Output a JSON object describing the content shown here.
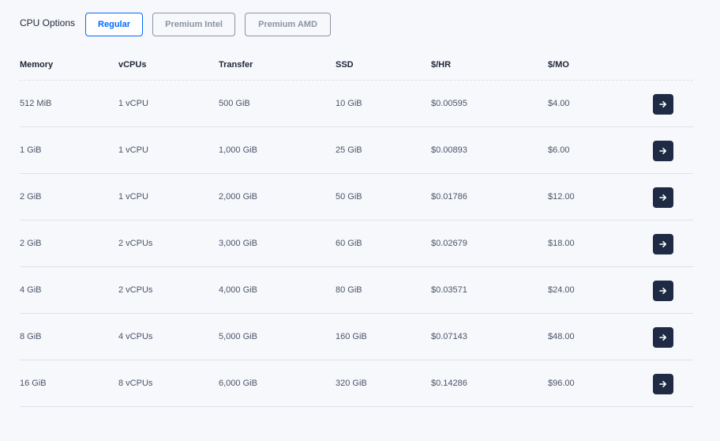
{
  "cpu_options": {
    "label": "CPU Options",
    "options": [
      {
        "label": "Regular",
        "selected": true
      },
      {
        "label": "Premium Intel",
        "selected": false
      },
      {
        "label": "Premium AMD",
        "selected": false
      }
    ]
  },
  "table": {
    "headers": [
      "Memory",
      "vCPUs",
      "Transfer",
      "SSD",
      "$/HR",
      "$/MO"
    ],
    "rows": [
      [
        "512 MiB",
        "1 vCPU",
        "500 GiB",
        "10 GiB",
        "$0.00595",
        "$4.00"
      ],
      [
        "1 GiB",
        "1 vCPU",
        "1,000 GiB",
        "25 GiB",
        "$0.00893",
        "$6.00"
      ],
      [
        "2 GiB",
        "1 vCPU",
        "2,000 GiB",
        "50 GiB",
        "$0.01786",
        "$12.00"
      ],
      [
        "2 GiB",
        "2 vCPUs",
        "3,000 GiB",
        "60 GiB",
        "$0.02679",
        "$18.00"
      ],
      [
        "4 GiB",
        "2 vCPUs",
        "4,000 GiB",
        "80 GiB",
        "$0.03571",
        "$24.00"
      ],
      [
        "8 GiB",
        "4 vCPUs",
        "5,000 GiB",
        "160 GiB",
        "$0.07143",
        "$48.00"
      ],
      [
        "16 GiB",
        "8 vCPUs",
        "6,000 GiB",
        "320 GiB",
        "$0.14286",
        "$96.00"
      ]
    ],
    "row_action_icon": "arrow-right-icon"
  },
  "colors": {
    "accent": "#0069ff",
    "action_button": "#1f2a44",
    "background": "#f7f8fc"
  }
}
